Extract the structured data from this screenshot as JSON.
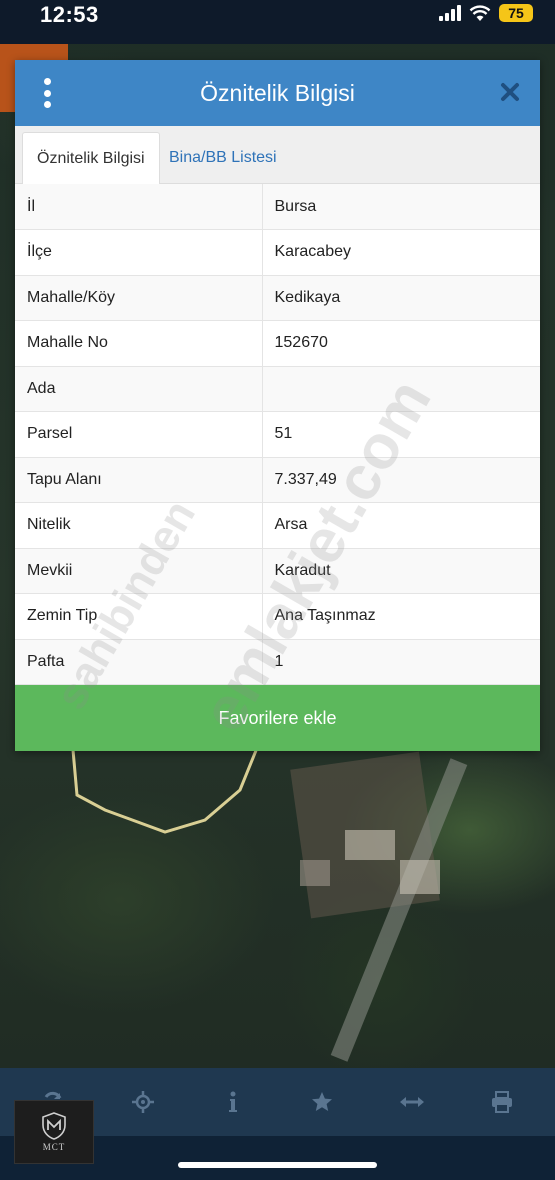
{
  "status_bar": {
    "time": "12:53",
    "battery": "75",
    "icons": [
      "signal-icon",
      "wifi-icon",
      "battery-icon"
    ]
  },
  "panel": {
    "title": "Öznitelik Bilgisi",
    "header_color": "#3e86c6",
    "tabs": [
      {
        "label": "Öznitelik Bilgisi",
        "active": true
      },
      {
        "label": "Bina/BB Listesi",
        "active": false
      }
    ],
    "rows": [
      {
        "label": "İl",
        "value": "Bursa"
      },
      {
        "label": "İlçe",
        "value": "Karacabey"
      },
      {
        "label": "Mahalle/Köy",
        "value": "Kedikaya"
      },
      {
        "label": "Mahalle No",
        "value": "152670"
      },
      {
        "label": "Ada",
        "value": ""
      },
      {
        "label": "Parsel",
        "value": "51"
      },
      {
        "label": "Tapu Alanı",
        "value": "7.337,49"
      },
      {
        "label": "Nitelik",
        "value": "Arsa"
      },
      {
        "label": "Mevkii",
        "value": "Karadut"
      },
      {
        "label": "Zemin Tip",
        "value": "Ana Taşınmaz"
      },
      {
        "label": "Pafta",
        "value": "1"
      }
    ],
    "favorite_button": "Favorilere ekle",
    "favorite_color": "#5cb85c"
  },
  "watermark": {
    "text_1": "emlakjet.com",
    "text_2": "sahibinden"
  },
  "toolbar": {
    "icons": [
      "refresh-icon",
      "locate-icon",
      "info-icon",
      "star-icon",
      "measure-icon",
      "print-icon"
    ]
  },
  "logo": {
    "text": "MCT"
  }
}
